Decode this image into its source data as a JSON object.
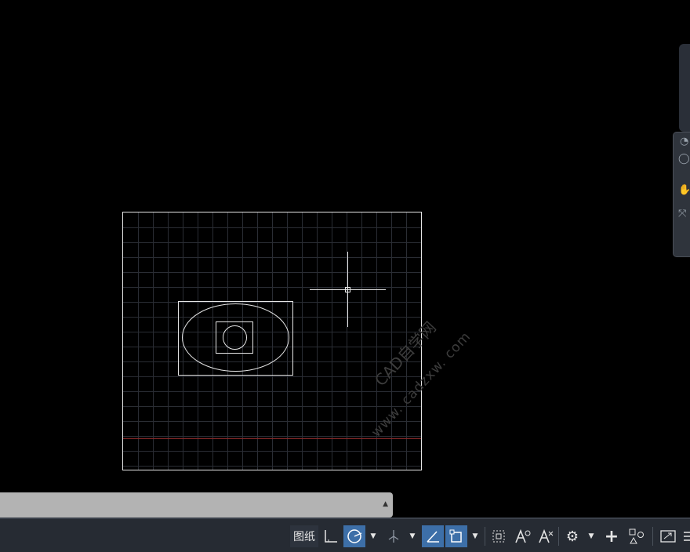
{
  "statusbar": {
    "model_space_label": "图纸",
    "buttons": [
      {
        "name": "snap-mode-icon",
        "on": false
      },
      {
        "name": "polar-tracking-icon",
        "on": true
      },
      {
        "name": "isometric-drafting-icon",
        "on": false
      },
      {
        "name": "object-snap-tracking-icon",
        "on": true
      },
      {
        "name": "object-snap-icon",
        "on": true
      },
      {
        "name": "selection-cycling-icon",
        "on": false
      },
      {
        "name": "annotation-scale-icon",
        "on": false
      },
      {
        "name": "annotation-visibility-icon",
        "on": false
      },
      {
        "name": "workspace-gear-icon",
        "on": false
      },
      {
        "name": "add-plus-icon",
        "on": false
      },
      {
        "name": "isolate-objects-icon",
        "on": false
      },
      {
        "name": "fullscreen-icon",
        "on": false
      },
      {
        "name": "customize-menu-icon",
        "on": false
      }
    ]
  },
  "watermark": {
    "site_name": "CAD自学网",
    "url": "www. cadzxw. com"
  },
  "colors": {
    "background": "#000000",
    "accent": "#3d6fa8",
    "statusbar": "#262b33",
    "command_line": "#b3b3b3"
  }
}
